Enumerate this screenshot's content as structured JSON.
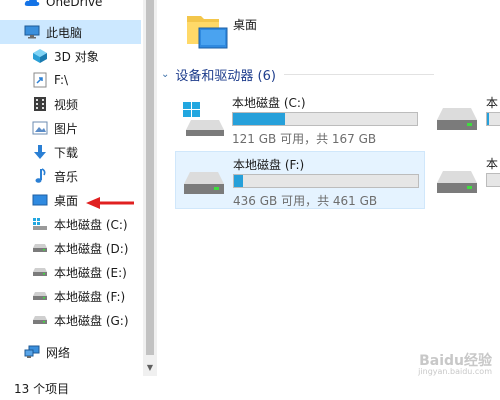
{
  "nav": {
    "items": [
      {
        "label": "OneDrive",
        "icon": "onedrive-icon"
      },
      {
        "label": "此电脑",
        "icon": "computer-icon",
        "selected": true
      },
      {
        "label": "3D 对象",
        "icon": "3d-objects-icon"
      },
      {
        "label": "F:\\",
        "icon": "folder-shortcut-icon"
      },
      {
        "label": "视频",
        "icon": "video-icon"
      },
      {
        "label": "图片",
        "icon": "picture-icon"
      },
      {
        "label": "下载",
        "icon": "download-icon"
      },
      {
        "label": "音乐",
        "icon": "music-icon"
      },
      {
        "label": "桌面",
        "icon": "desktop-icon"
      },
      {
        "label": "本地磁盘 (C:)",
        "icon": "system-drive-icon"
      },
      {
        "label": "本地磁盘 (D:)",
        "icon": "drive-icon"
      },
      {
        "label": "本地磁盘 (E:)",
        "icon": "drive-icon"
      },
      {
        "label": "本地磁盘 (F:)",
        "icon": "drive-icon"
      },
      {
        "label": "本地磁盘 (G:)",
        "icon": "drive-icon"
      },
      {
        "label": "网络",
        "icon": "network-icon"
      }
    ]
  },
  "main": {
    "folder": {
      "label": "桌面",
      "icon": "desktop-folder-icon"
    },
    "section": {
      "title": "设备和驱动器 (6)"
    },
    "drives": [
      {
        "name": "本地磁盘 (C:)",
        "info": "121 GB 可用，共 167 GB",
        "used_fraction": 0.28,
        "icon": "system-drive-icon"
      },
      {
        "name": "本地磁盘 (F:)",
        "info": "436 GB 可用，共 461 GB",
        "used_fraction": 0.05,
        "icon": "drive-icon",
        "selected": true
      },
      {
        "name": "本",
        "info": "",
        "used_fraction": 0.1,
        "icon": "drive-icon"
      },
      {
        "name": "本",
        "info": "",
        "used_fraction": 0.0,
        "icon": "drive-icon"
      }
    ]
  },
  "status": {
    "text": "13 个项目"
  },
  "watermark": {
    "text": "Baidu经验",
    "sub": "jingyan.baidu.com"
  },
  "colors": {
    "selection": "#cce8ff",
    "bar_fill": "#26a0da",
    "arrow": "#e02020"
  }
}
